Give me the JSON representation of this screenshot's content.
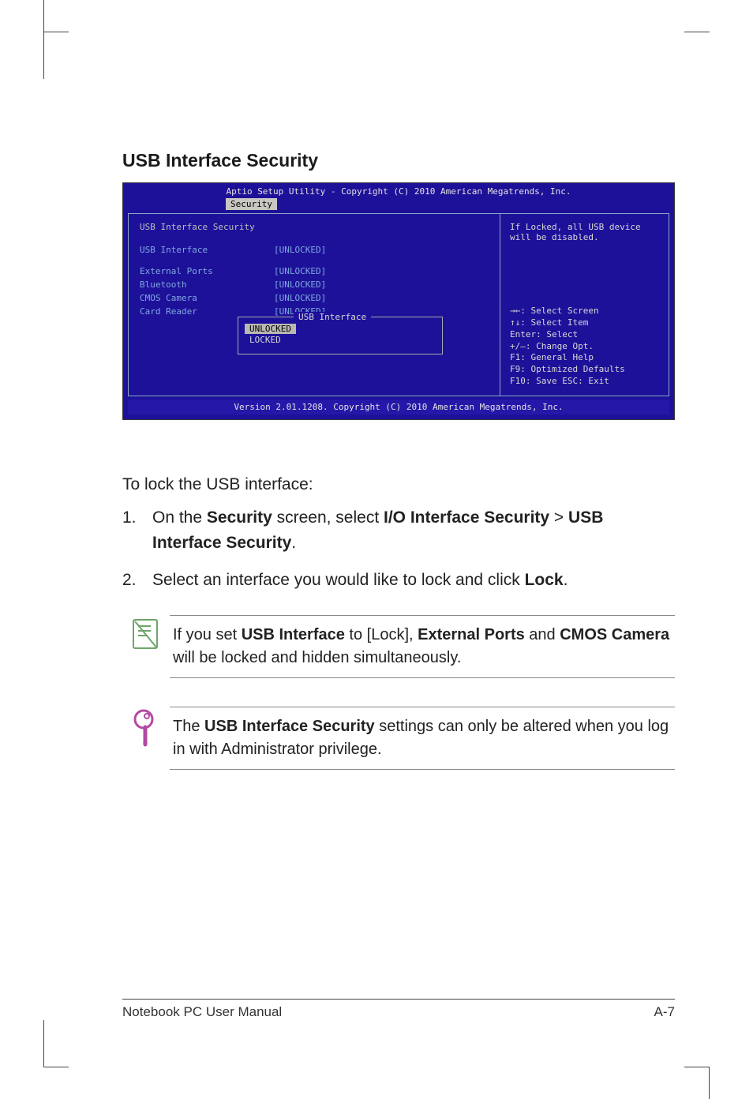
{
  "heading": "USB Interface Security",
  "bios": {
    "topbar": "Aptio Setup Utility - Copyright (C) 2010 American Megatrends, Inc.",
    "tab": "Security",
    "section_title": "USB Interface Security",
    "rows": [
      {
        "label": "USB Interface",
        "value": "[UNLOCKED]"
      },
      {
        "label": "External Ports",
        "value": "[UNLOCKED]"
      },
      {
        "label": "Bluetooth",
        "value": "[UNLOCKED]"
      },
      {
        "label": "CMOS Camera",
        "value": "[UNLOCKED]"
      },
      {
        "label": "Card Reader",
        "value": "[UNLOCKED]"
      }
    ],
    "popup": {
      "title": "USB Interface",
      "options": [
        "UNLOCKED",
        "LOCKED"
      ]
    },
    "right_help": "If Locked, all USB device will be disabled.",
    "keys": {
      "l1": "→←: Select Screen",
      "l2": "↑↓:   Select Item",
      "l3": "Enter: Select",
      "l4": "+/—:  Change Opt.",
      "l5": "F1:    General Help",
      "l6": "F9:    Optimized Defaults",
      "l7": "F10:  Save    ESC: Exit"
    },
    "footer": "Version 2.01.1208. Copyright (C) 2010 American Megatrends, Inc."
  },
  "intro": "To lock the USB interface:",
  "steps": {
    "s1_num": "1.",
    "s1_a": "On the ",
    "s1_b": "Security",
    "s1_c": " screen, select ",
    "s1_d": "I/O Interface Security",
    "s1_e": " > ",
    "s1_f": "USB Interface Security",
    "s1_g": ".",
    "s2_num": "2.",
    "s2_a": "Select an interface you would like to lock and click ",
    "s2_b": "Lock",
    "s2_c": "."
  },
  "note1": {
    "a": "If you set ",
    "b": "USB Interface",
    "c": " to [Lock], ",
    "d": "External Ports",
    "e": " and ",
    "f": "CMOS Camera",
    "g": " will be locked and hidden simultaneously."
  },
  "note2": {
    "a": "The ",
    "b": "USB Interface Security",
    "c": " settings can only be altered when you log in with Administrator privilege."
  },
  "footer": {
    "left": "Notebook PC User Manual",
    "right": "A-7"
  }
}
